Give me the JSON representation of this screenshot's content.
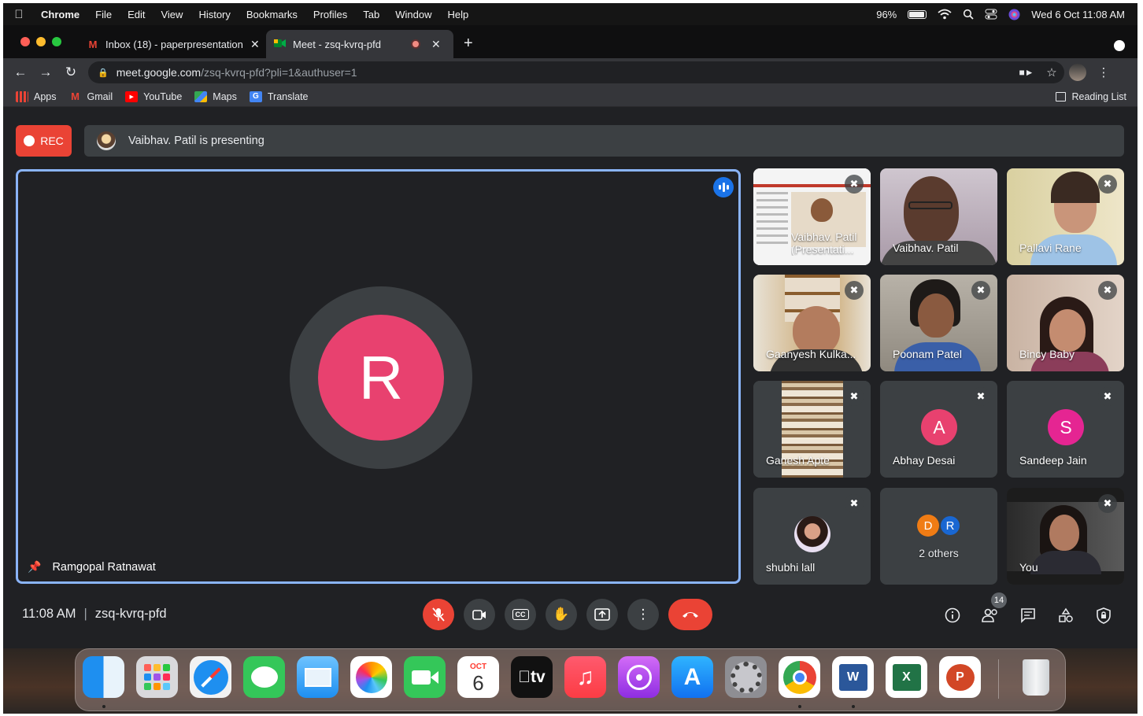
{
  "menubar": {
    "app": "Chrome",
    "items": [
      "File",
      "Edit",
      "View",
      "History",
      "Bookmarks",
      "Profiles",
      "Tab",
      "Window",
      "Help"
    ],
    "battery": "96%",
    "battery_level": 0.96,
    "datetime": "Wed 6 Oct  11:08 AM"
  },
  "tabs": [
    {
      "title": "Inbox (18) - paperpresentation",
      "icon": "gmail-icon",
      "close": "✕"
    },
    {
      "title": "Meet - zsq-kvrq-pfd",
      "icon": "meet-icon",
      "close": "✕"
    }
  ],
  "newtab": "+",
  "toolbar": {
    "url_host": "meet.google.com",
    "url_path": "/zsq-kvrq-pfd?pli=1&authuser=1"
  },
  "bookmarks": {
    "items": [
      {
        "label": "Apps",
        "icon": "apps-grid-icon"
      },
      {
        "label": "Gmail",
        "icon": "gmail-icon"
      },
      {
        "label": "YouTube",
        "icon": "youtube-icon"
      },
      {
        "label": "Maps",
        "icon": "maps-icon"
      },
      {
        "label": "Translate",
        "icon": "translate-icon"
      }
    ],
    "reading_list": "Reading List"
  },
  "meet": {
    "rec_label": "REC",
    "presenting_text": "Vaibhav. Patil is presenting",
    "main": {
      "initial": "R",
      "name": "Ramgopal Ratnawat",
      "avatar_color": "#e8416f"
    },
    "tiles": [
      {
        "name": "Vaibhav. Patil (Presentati...",
        "type": "presentation"
      },
      {
        "name": "Vaibhav. Patil",
        "type": "video"
      },
      {
        "name": "Pallavi Rane",
        "type": "video"
      },
      {
        "name": "Gaanyesh Kulka...",
        "type": "video"
      },
      {
        "name": "Poonam Patel",
        "type": "video"
      },
      {
        "name": "Bincy Baby",
        "type": "video"
      },
      {
        "name": "Ganesh Apte",
        "type": "video"
      },
      {
        "name": "Abhay Desai",
        "type": "avatar",
        "initial": "A",
        "color": "#e8416f"
      },
      {
        "name": "Sandeep Jain",
        "type": "avatar",
        "initial": "S",
        "color": "#e52592"
      },
      {
        "name": "shubhi lall",
        "type": "photo-avatar"
      },
      {
        "name": "2 others",
        "type": "others",
        "initials": [
          "D",
          "R"
        ],
        "colors": [
          "#f07c14",
          "#1967d2"
        ]
      },
      {
        "name": "You",
        "type": "video"
      }
    ],
    "time": "11:08 AM",
    "meeting_code": "zsq-kvrq-pfd",
    "participants_count": "14"
  },
  "dock": {
    "apps": [
      "Finder",
      "Launchpad",
      "Safari",
      "Messages",
      "Mail",
      "Photos",
      "FaceTime",
      "Calendar",
      "TV",
      "Music",
      "Podcasts",
      "App Store",
      "System Preferences",
      "Chrome",
      "Word",
      "Excel",
      "PowerPoint",
      "Trash"
    ],
    "calendar_month": "OCT",
    "calendar_day": "6",
    "tv_label": "tv"
  }
}
